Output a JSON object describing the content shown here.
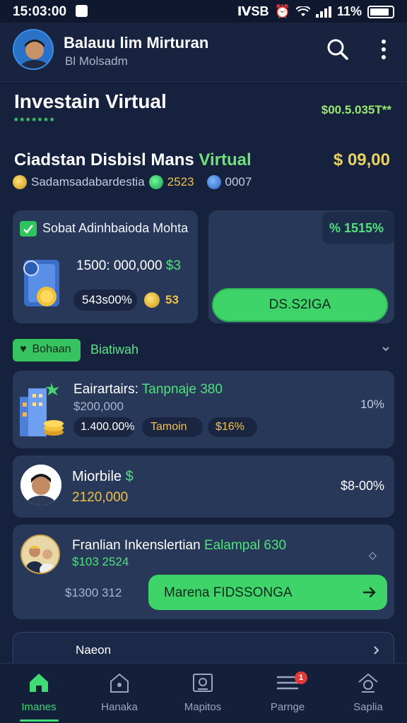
{
  "status": {
    "time": "15:03:00",
    "icons_text": "ⅣSB",
    "battery_pct": "11%"
  },
  "header": {
    "user_name": "Balauu lim Mirturan",
    "user_sub": "Bl Molsadm"
  },
  "portfolio": {
    "title": "Investain Virtual",
    "stars": "*******",
    "value": "$00.5.035T**"
  },
  "section": {
    "title": "Ciadstan Disbisl Mans",
    "title_highlight": "Virtual",
    "amount": "$ 09,00",
    "chip1": "Sadamsadabardestia",
    "chip2": "2523",
    "chip3": "0007"
  },
  "card_left": {
    "title": "Sobat Adinhbaioda Mohta",
    "amount": "1500: 000,000",
    "amount_suffix": "$3",
    "stat": "543s00%",
    "coin_val": "53"
  },
  "card_right": {
    "badge": "% 1515%",
    "button": "DS.S2IGA"
  },
  "filter": {
    "chip": "Bohaan",
    "label": "Biatiwah"
  },
  "list": [
    {
      "title": "Eairartairs:",
      "title_highlight": "Tanpnaje 380",
      "sub": "$200,000",
      "pct": "10%",
      "pill1": "1.400.00%",
      "pill2": "Tamoin",
      "pill3": "$16%"
    },
    {
      "title": "Miorbile",
      "title_highlight": "$",
      "amount": "2120,000",
      "right": "$8-00%"
    },
    {
      "title": "Franlian Inkenslertian",
      "title_highlight": "Ealampal 630",
      "sub": "$103 2524",
      "small": "◇",
      "left_value": "$1300 312",
      "button": "Marena FIDSSONGA"
    },
    {
      "label": "Naeon"
    }
  ],
  "nav": {
    "items": [
      {
        "label": "Imanes",
        "icon": "home-icon"
      },
      {
        "label": "Hanaka",
        "icon": "house-outline-icon"
      },
      {
        "label": "Mapitos",
        "icon": "map-icon"
      },
      {
        "label": "Parnge",
        "icon": "list-icon"
      },
      {
        "label": "Saplia",
        "icon": "settings-house-icon"
      }
    ],
    "badge_count": "1"
  },
  "colors": {
    "accent": "#3ed469",
    "gold": "#f0c348",
    "bg": "#15213d",
    "card": "#273859"
  }
}
